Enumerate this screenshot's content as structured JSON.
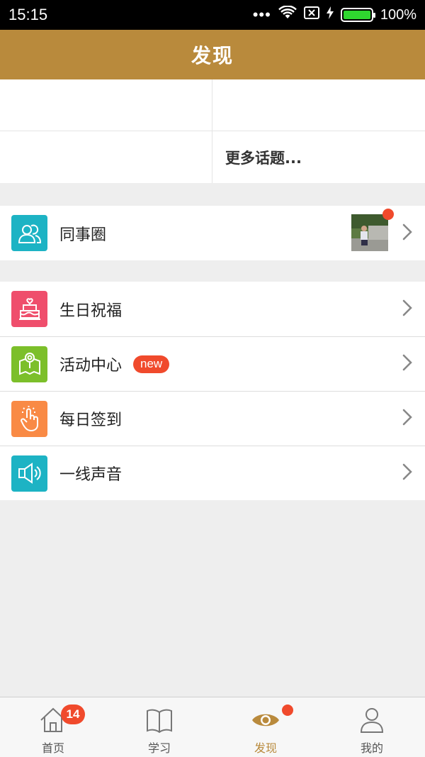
{
  "status_bar": {
    "time": "15:15",
    "dots": "•••",
    "battery_text": "100%",
    "battery_level": 1.0,
    "icons": [
      "wifi-icon",
      "no-sim-icon",
      "charging-icon",
      "battery-icon"
    ]
  },
  "colors": {
    "header": "#b98a3c",
    "active_nav": "#b98a3c",
    "badge_red": "#f04a2c",
    "battery_green": "#2fd62f",
    "moments_icon": "#1db3c4",
    "birthday_icon": "#ef4e6c",
    "activity_icon": "#7cbf2a",
    "checkin_icon": "#f98a45",
    "voice_icon": "#1db3c4"
  },
  "header": {
    "title": "发现"
  },
  "topics": {
    "cells": [
      "",
      "",
      "",
      "更多话题..."
    ]
  },
  "moments": {
    "label": "同事圈",
    "icon": "people-icon",
    "has_unread": true
  },
  "menu": {
    "items": [
      {
        "label": "生日祝福",
        "icon": "birthday-cake-icon"
      },
      {
        "label": "活动中心",
        "icon": "activity-map-icon",
        "badge": "new"
      },
      {
        "label": "每日签到",
        "icon": "tap-hand-icon"
      },
      {
        "label": "一线声音",
        "icon": "megaphone-icon"
      }
    ]
  },
  "bottom_nav": {
    "items": [
      {
        "label": "首页",
        "icon": "home-icon",
        "badge": "14"
      },
      {
        "label": "学习",
        "icon": "book-icon"
      },
      {
        "label": "发现",
        "icon": "eye-icon",
        "active": true,
        "has_dot": true
      },
      {
        "label": "我的",
        "icon": "user-icon"
      }
    ]
  }
}
